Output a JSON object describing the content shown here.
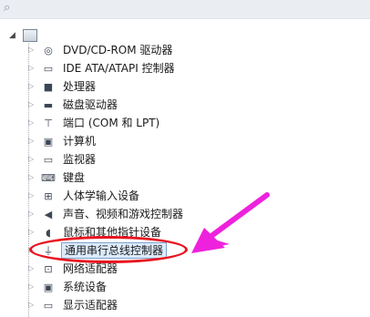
{
  "toolbar": {
    "icon": "computer-icon"
  },
  "tree": {
    "root": {
      "icon": "computer-icon",
      "expanded": true
    },
    "items": [
      {
        "label": "DVD/CD-ROM 驱动器",
        "icon": "dvd-drive-icon",
        "glyph": "◎"
      },
      {
        "label": "IDE ATA/ATAPI 控制器",
        "icon": "ide-controller-icon",
        "glyph": "▭"
      },
      {
        "label": "处理器",
        "icon": "processor-icon",
        "glyph": "■"
      },
      {
        "label": "磁盘驱动器",
        "icon": "disk-drive-icon",
        "glyph": "▬"
      },
      {
        "label": "端口 (COM 和 LPT)",
        "icon": "port-icon",
        "glyph": "⊤"
      },
      {
        "label": "计算机",
        "icon": "computer-icon",
        "glyph": "▣"
      },
      {
        "label": "监视器",
        "icon": "monitor-icon",
        "glyph": "▭"
      },
      {
        "label": "键盘",
        "icon": "keyboard-icon",
        "glyph": "⌨"
      },
      {
        "label": "人体学输入设备",
        "icon": "hid-icon",
        "glyph": "⊞"
      },
      {
        "label": "声音、视频和游戏控制器",
        "icon": "speaker-icon",
        "glyph": "◀"
      },
      {
        "label": "鼠标和其他指针设备",
        "icon": "mouse-icon",
        "glyph": "◖"
      },
      {
        "label": "通用串行总线控制器",
        "icon": "usb-icon",
        "glyph": "⏚",
        "selected": true
      },
      {
        "label": "网络适配器",
        "icon": "network-adapter-icon",
        "glyph": "⊡"
      },
      {
        "label": "系统设备",
        "icon": "system-device-icon",
        "glyph": "▣"
      },
      {
        "label": "显示适配器",
        "icon": "display-adapter-icon",
        "glyph": "▭"
      }
    ]
  },
  "annotation": {
    "ellipse_color": "#e8141f",
    "arrow_color": "#ee22dd"
  }
}
